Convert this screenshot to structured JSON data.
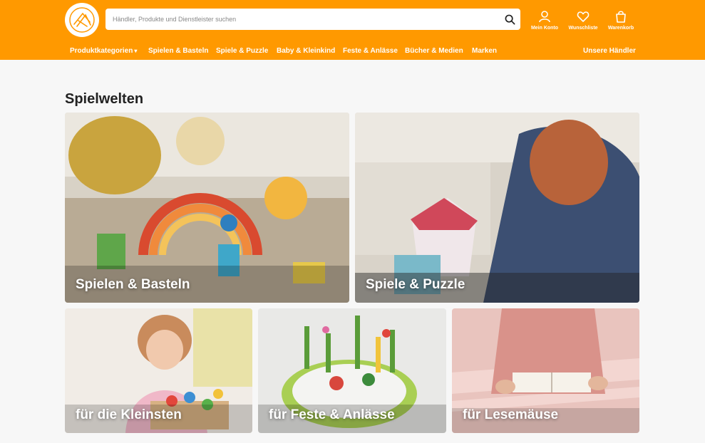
{
  "search": {
    "placeholder": "Händler, Produkte und Dienstleister suchen"
  },
  "header_actions": [
    {
      "label": "Mein Konto",
      "icon": "user-icon"
    },
    {
      "label": "Wunschliste",
      "icon": "heart-icon"
    },
    {
      "label": "Warenkorb",
      "icon": "shopping-bag-icon"
    }
  ],
  "nav": {
    "items": [
      {
        "label": "Produktkategorien",
        "has_dropdown": true
      },
      {
        "label": "Spielen & Basteln"
      },
      {
        "label": "Spiele & Puzzle"
      },
      {
        "label": "Baby & Kleinkind"
      },
      {
        "label": "Feste & Anlässe"
      },
      {
        "label": "Bücher & Medien"
      },
      {
        "label": "Marken"
      }
    ],
    "right_link": "Unsere Händler",
    "dropdown_caret": "▾"
  },
  "main": {
    "heading": "Spielwelten",
    "tiles": [
      {
        "label": "Spielen & Basteln"
      },
      {
        "label": "Spiele & Puzzle"
      },
      {
        "label": "für die Kleinsten"
      },
      {
        "label": "für Feste & Anlässe"
      },
      {
        "label": "für Lesemäuse"
      }
    ]
  },
  "colors": {
    "brand": "#ff9900",
    "background": "#f7f7f7",
    "text": "#222222"
  }
}
